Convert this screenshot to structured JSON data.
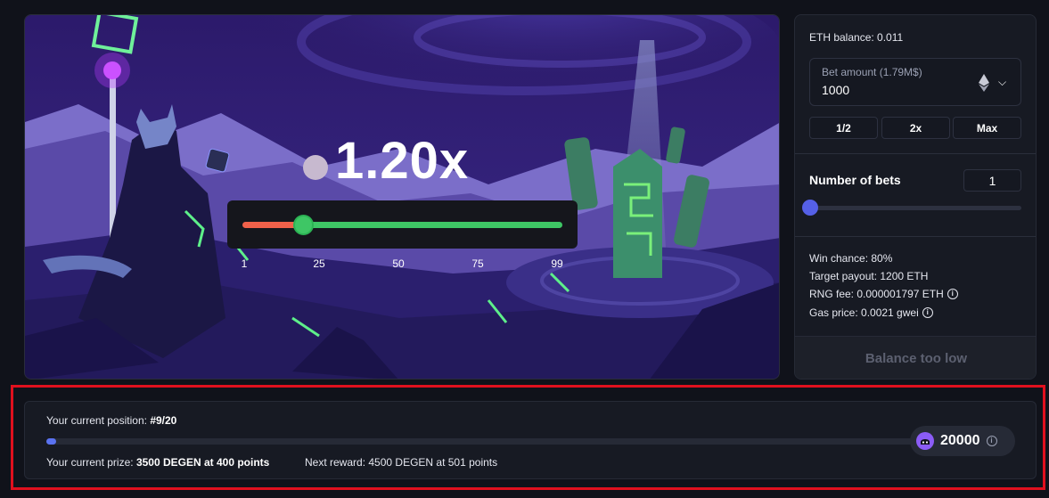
{
  "game": {
    "multiplier": "1.20x",
    "slider_value": 25,
    "slider_ticks": [
      "1",
      "25",
      "50",
      "75",
      "99"
    ],
    "colors": {
      "lose": "#f0614a",
      "win": "#3ec665"
    }
  },
  "panel": {
    "eth_balance": "ETH balance: 0.011",
    "bet_amount_label": "Bet amount (1.79M$)",
    "bet_amount_value": "1000",
    "currency_icon": "ethereum-icon",
    "half_label": "1/2",
    "double_label": "2x",
    "max_label": "Max",
    "number_of_bets_label": "Number of bets",
    "number_of_bets_value": "1",
    "win_chance": "Win chance: 80%",
    "target_payout": "Target payout: 1200 ETH",
    "rng_fee": "RNG fee: 0.000001797 ETH",
    "gas_price": "Gas price: 0.0021 gwei",
    "action_label": "Balance too low"
  },
  "leaderboard": {
    "position_label": "Your current position:",
    "position_value": "#9/20",
    "progress_fraction": 0.011,
    "prize_label": "Your current prize:",
    "prize_value": "3500 DEGEN at 400 points",
    "next_label": "Next reward:",
    "next_value": "4500 DEGEN at 501 points",
    "points": "20000",
    "accent": "#5a72f0"
  }
}
